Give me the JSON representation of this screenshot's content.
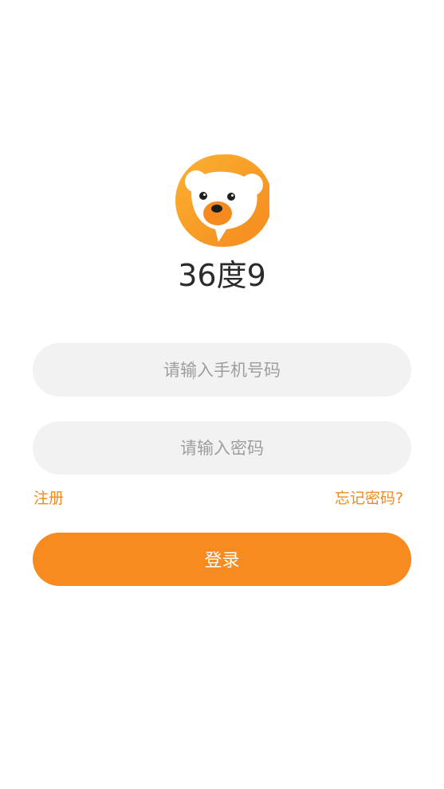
{
  "app": {
    "name": "36度9",
    "logo_icon": "bear-logo-icon"
  },
  "form": {
    "phone_placeholder": "请输入手机号码",
    "phone_value": "",
    "password_placeholder": "请输入密码",
    "password_value": ""
  },
  "links": {
    "register": "注册",
    "forgot_password": "忘记密码?"
  },
  "actions": {
    "login": "登录"
  },
  "colors": {
    "accent": "#f88b1f",
    "link": "#f08a1c",
    "input_bg": "#f2f2f2",
    "title_text": "#2b2b2b"
  }
}
